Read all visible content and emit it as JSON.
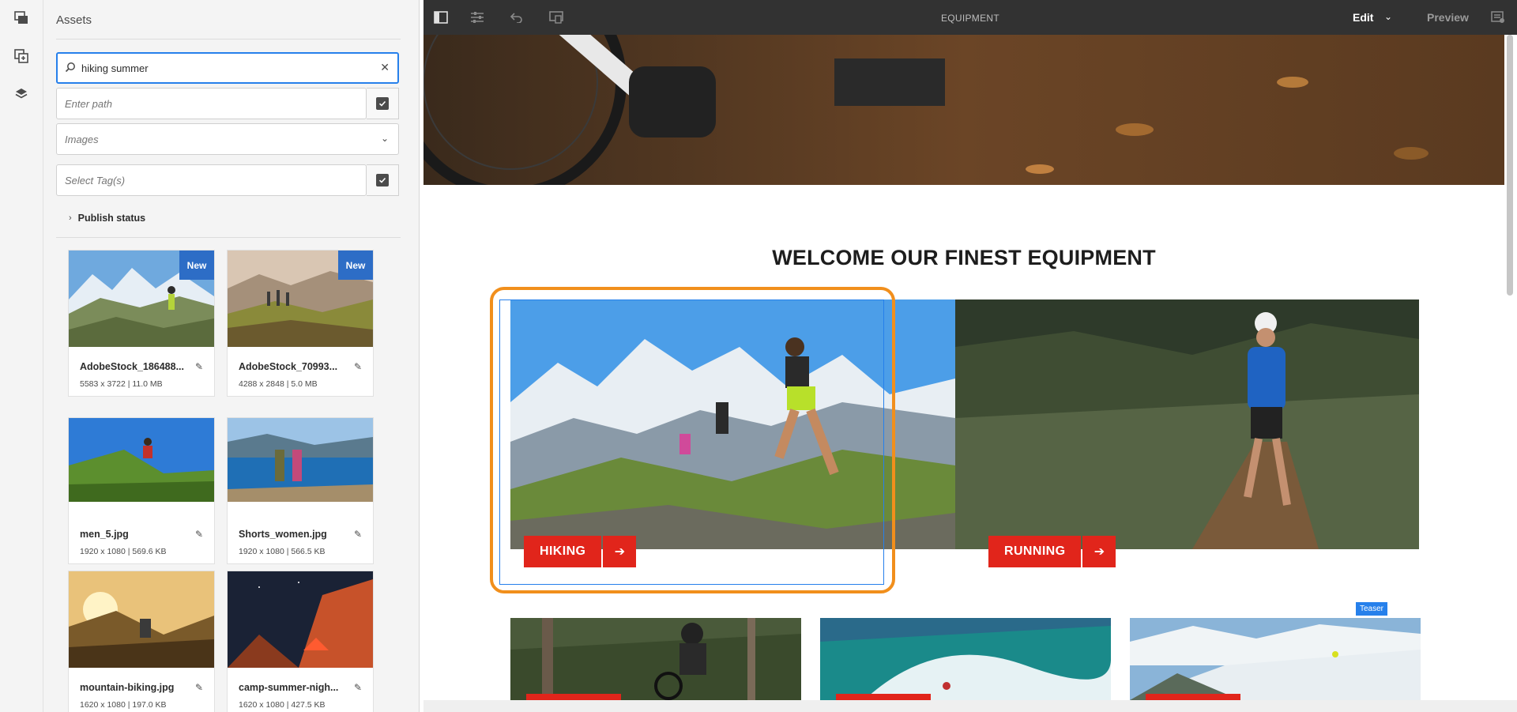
{
  "panel": {
    "title": "Assets",
    "search_value": "hiking summer",
    "path_placeholder": "Enter path",
    "type_value": "Images",
    "tags_placeholder": "Select Tag(s)",
    "publish_status": "Publish status",
    "badge_new": "New"
  },
  "assets": [
    {
      "name": "AdobeStock_186488...",
      "meta": "5583 x 3722 | 11.0 MB",
      "new": true
    },
    {
      "name": "AdobeStock_70993...",
      "meta": "4288 x 2848 | 5.0 MB",
      "new": true
    },
    {
      "name": "men_5.jpg",
      "meta": "1920 x 1080 | 569.6 KB",
      "new": false
    },
    {
      "name": "Shorts_women.jpg",
      "meta": "1920 x 1080 | 566.5 KB",
      "new": false
    },
    {
      "name": "mountain-biking.jpg",
      "meta": "1620 x 1080 | 197.0 KB",
      "new": false
    },
    {
      "name": "camp-summer-nigh...",
      "meta": "1620 x 1080 | 427.5 KB",
      "new": false
    }
  ],
  "toolbar": {
    "title": "EQUIPMENT",
    "mode": "Edit",
    "preview": "Preview"
  },
  "page": {
    "heading": "WELCOME OUR FINEST EQUIPMENT",
    "teaser1": "HIKING",
    "teaser2": "RUNNING",
    "component_label": "Teaser"
  },
  "colors": {
    "accent": "#2680eb",
    "cta_red": "#e1251b",
    "selection_orange": "#f18f1c",
    "toolbar_bg": "#323232",
    "badge_blue": "#2d6dc6"
  }
}
